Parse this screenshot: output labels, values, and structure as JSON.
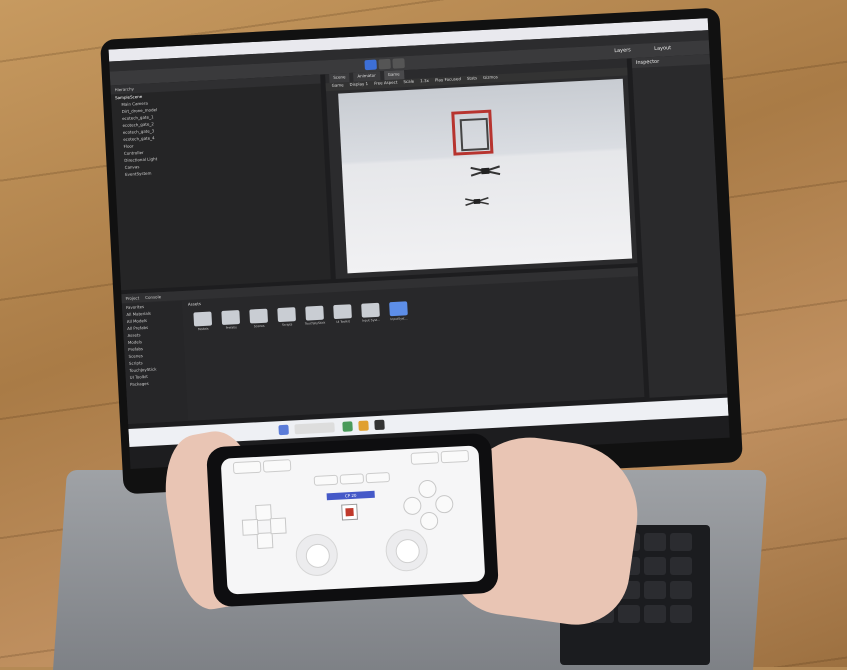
{
  "scene": {
    "subject": "laptop-running-unity-editor-with-phone-gamepad"
  },
  "editor": {
    "hierarchy": {
      "tab_label": "Hierarchy",
      "root": "SampleScene",
      "items": [
        "Main Camera",
        "Dirt_drone_model",
        "ecotech_gate_1",
        "ecotech_gate_2",
        "ecotech_gate_3",
        "ecotech_gate_4",
        "Floor",
        "Controller",
        "Directional Light",
        "Canvas",
        "EventSystem"
      ]
    },
    "scene_tabs": [
      "Scene",
      "Animator",
      "Game"
    ],
    "game_bar": {
      "game_label": "Game",
      "display": "Display 1",
      "aspect": "Free Aspect",
      "scale_label": "Scale",
      "scale_value": "1.3x",
      "play_mode": "Play Focused",
      "stats": "Stats",
      "gizmos": "Gizmos"
    },
    "top_right": {
      "layers": "Layers",
      "layout": "Layout"
    },
    "inspector_title": "Inspector",
    "project": {
      "tabs": [
        "Project",
        "Console"
      ],
      "tree": [
        "Favorites",
        "All Materials",
        "All Models",
        "All Prefabs",
        "Assets",
        "Models",
        "Prefabs",
        "Scenes",
        "Scripts",
        "TouchJoyStick",
        "UI Toolkit",
        "Packages"
      ],
      "assets_title": "Assets",
      "assets": [
        "Models",
        "Prefabs",
        "Scenes",
        "Scripts",
        "TouchJoyStick",
        "UI Toolkit",
        "Input Syst...",
        "InputSyst..."
      ]
    }
  },
  "phone": {
    "status_label": "CP 20",
    "colors": {
      "status_bar": "#4559c8",
      "status_icon": "#c0392b"
    }
  }
}
